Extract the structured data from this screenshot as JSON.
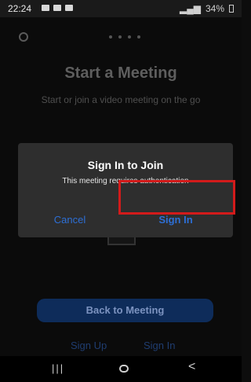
{
  "status": {
    "time": "22:24",
    "right": "34%"
  },
  "app": {
    "title": "Start a Meeting",
    "subtitle": "Start or join a video meeting on the go",
    "back_button": "Back to Meeting",
    "sign_up_link": "Sign Up",
    "sign_in_link": "Sign In"
  },
  "dialog": {
    "title": "Sign In to Join",
    "message": "This meeting requires authentication",
    "cancel_label": "Cancel",
    "sign_in_label": "Sign In"
  },
  "nav": {
    "menu": "|||",
    "back": "<"
  },
  "icons": {
    "settings": "gear-icon",
    "page_indicator": "dots-icon",
    "home": "home-icon",
    "back": "back-icon",
    "menu": "recent-apps-icon"
  }
}
